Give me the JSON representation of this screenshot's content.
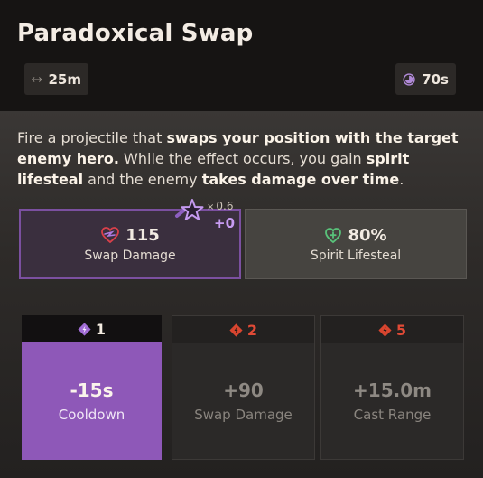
{
  "ability": {
    "title": "Paradoxical Swap",
    "range": {
      "icon": "range-arrows-icon",
      "value": "25m"
    },
    "cooldown": {
      "icon": "cooldown-clock-icon",
      "value": "70s"
    }
  },
  "description": {
    "part1": "Fire a projectile that ",
    "bold1": "swaps your position with the target enemy hero.",
    "part2": " While the effect occurs, you gain ",
    "bold2": "spirit lifesteal",
    "part3": " and the enemy ",
    "bold3": "takes damage over time",
    "part4": "."
  },
  "stats": {
    "damage": {
      "icon": "spirit-damage-icon",
      "value": "115",
      "label": "Swap Damage"
    },
    "lifesteal": {
      "icon": "heart-plus-icon",
      "value": "80%",
      "label": "Spirit Lifesteal"
    },
    "scaling": {
      "icon": "spirit-scaling-star-icon",
      "multiplier_prefix": "×",
      "multiplier": "0.6",
      "bonus": "+0"
    }
  },
  "upgrades": [
    {
      "cost": "1",
      "value": "-15s",
      "label": "Cooldown",
      "state": "unlocked"
    },
    {
      "cost": "2",
      "value": "+90",
      "label": "Swap Damage",
      "state": "locked"
    },
    {
      "cost": "5",
      "value": "+15.0m",
      "label": "Cast Range",
      "state": "locked"
    }
  ],
  "colors": {
    "accent_purple": "#8e58b8",
    "locked_red": "#e04a36",
    "lifesteal_green": "#59c27a"
  }
}
